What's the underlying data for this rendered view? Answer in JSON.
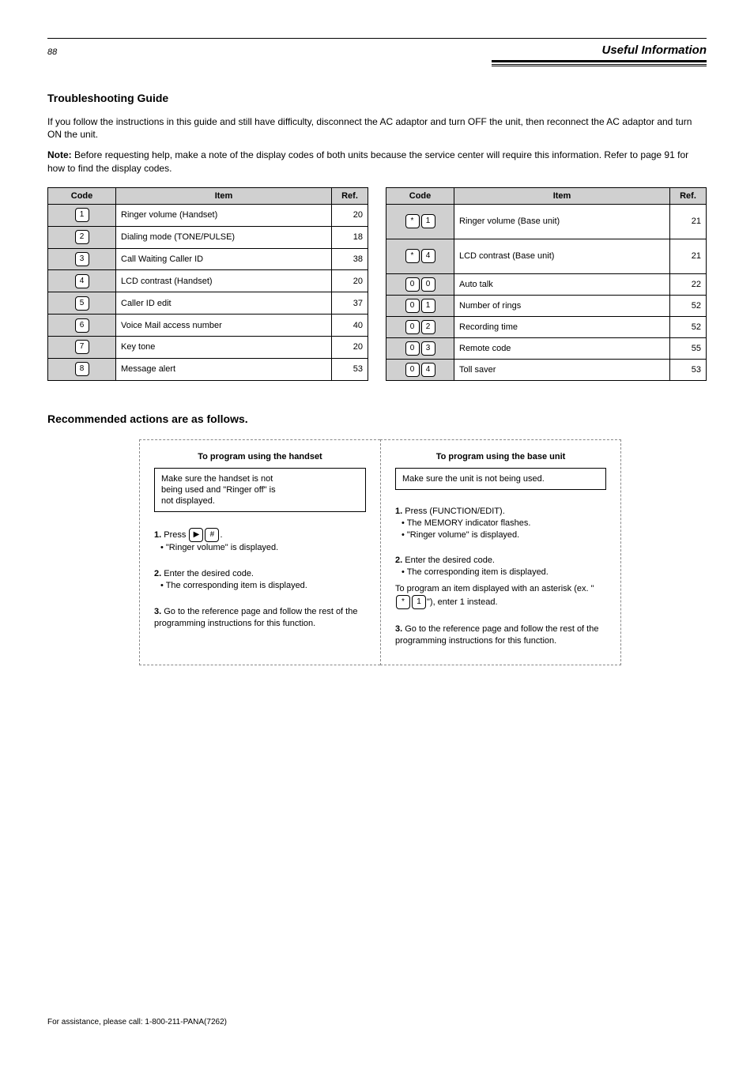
{
  "header": {
    "page_number": "88",
    "section_title": "Useful Information"
  },
  "subsection": {
    "title": "Troubleshooting Guide",
    "intro": "If you follow the instructions in this guide and still have difficulty, disconnect the AC adaptor and turn OFF the unit, then reconnect the AC adaptor and turn ON the unit.",
    "note": "Before requesting help, make a note of the display codes of both units because the service center will require this information. Refer to page 91 for how to find the display codes."
  },
  "tables": {
    "headers": [
      "Code",
      "Item",
      "Ref."
    ],
    "left": [
      {
        "keys": [
          "1"
        ],
        "item": "Ringer volume (Handset)",
        "ref": "20"
      },
      {
        "keys": [
          "2"
        ],
        "item": "Dialing mode (TONE/PULSE)",
        "ref": "18"
      },
      {
        "keys": [
          "3"
        ],
        "item": "Call Waiting Caller ID",
        "ref": "38"
      },
      {
        "keys": [
          "4"
        ],
        "item": "LCD contrast (Handset)",
        "ref": "20"
      },
      {
        "keys": [
          "5"
        ],
        "item": "Caller ID edit",
        "ref": "37"
      },
      {
        "keys": [
          "6"
        ],
        "item": "Voice Mail access number",
        "ref": "40"
      },
      {
        "keys": [
          "7"
        ],
        "item": "Key tone",
        "ref": "20"
      },
      {
        "keys": [
          "8"
        ],
        "item": "Message alert",
        "ref": "53"
      }
    ],
    "right": [
      {
        "keys": [
          "*",
          "1"
        ],
        "item": "Ringer volume (Base unit)",
        "ref": "21",
        "double_height": true
      },
      {
        "keys": [
          "*",
          "4"
        ],
        "item": "LCD contrast (Base unit)",
        "ref": "21",
        "double_height": true
      },
      {
        "keys": [
          "0",
          "0"
        ],
        "item": "Auto talk",
        "ref": "22"
      },
      {
        "keys": [
          "0",
          "1"
        ],
        "item": "Number of rings",
        "ref": "52"
      },
      {
        "keys": [
          "0",
          "2"
        ],
        "item": "Recording time",
        "ref": "52"
      },
      {
        "keys": [
          "0",
          "3"
        ],
        "item": "Remote code",
        "ref": "55"
      },
      {
        "keys": [
          "0",
          "4"
        ],
        "item": "Toll saver",
        "ref": "53"
      }
    ]
  },
  "actions": {
    "title": "Recommended actions are as follows.",
    "left": {
      "heading": "To program using the handset",
      "box_lines": [
        "Make sure the handset is not",
        "being used and \"Ringer off\" is",
        "not displayed."
      ],
      "step1_label": "1.",
      "step1_text_a": "Press",
      "step1_keys": [
        "▶",
        "#"
      ],
      "step1_text_b": ".",
      "step1_sub": "• \"Ringer volume\" is displayed.",
      "step2_label": "2.",
      "step2_text": "Enter the desired code.",
      "step2_sub": "• The corresponding item is displayed.",
      "step3_label": "3.",
      "step3_text": "Go to the reference page and follow the rest of the programming instructions for this function."
    },
    "right": {
      "heading": "To program using the base unit",
      "box": "Make sure the unit is not being used.",
      "step1_label": "1.",
      "step1_text": "Press (FUNCTION/EDIT).",
      "step1_sub1": "• The MEMORY indicator flashes.",
      "step1_sub2": "• \"Ringer volume\" is displayed.",
      "step2_label": "2.",
      "step2_text": "Enter the desired code.",
      "step2_sub": "• The corresponding item is displayed.",
      "step2_note_a": "To program an item displayed with an asterisk (ex. \"",
      "step2_keys": [
        "*",
        "1"
      ],
      "step2_note_b": "\"), enter 1 instead.",
      "step3_label": "3.",
      "step3_text": "Go to the reference page and follow the rest of the programming instructions for this function."
    }
  },
  "footer": {
    "left": "For assistance, please call: 1-800-211-PANA(7262)",
    "right": ""
  }
}
